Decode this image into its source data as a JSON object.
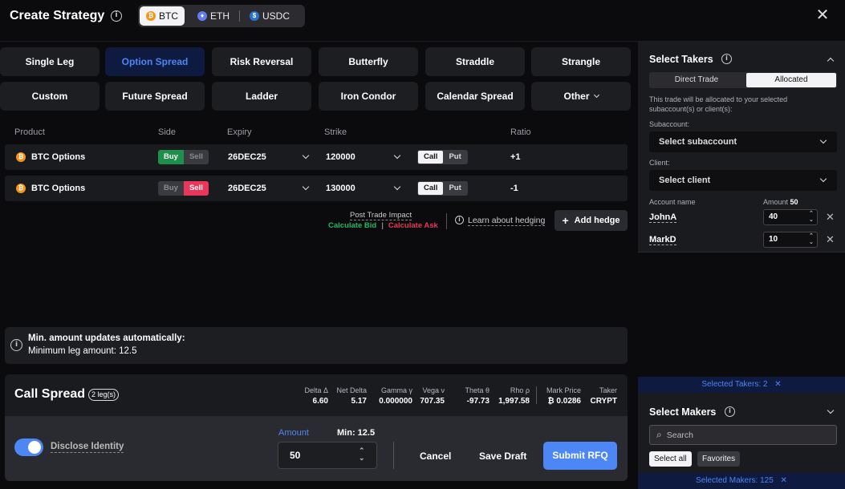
{
  "header": {
    "title": "Create Strategy",
    "assets": [
      {
        "label": "BTC",
        "active": true
      },
      {
        "label": "ETH",
        "active": false
      },
      {
        "label": "USDC",
        "active": false
      }
    ]
  },
  "strategies": [
    "Single Leg",
    "Option Spread",
    "Risk Reversal",
    "Butterfly",
    "Straddle",
    "Strangle",
    "Custom",
    "Future Spread",
    "Ladder",
    "Iron Condor",
    "Calendar Spread",
    "Other"
  ],
  "active_strategy": "Option Spread",
  "table": {
    "headers": [
      "Product",
      "Side",
      "Expiry",
      "Strike",
      "Ratio"
    ],
    "legs": [
      {
        "product": "BTC Options",
        "side_buy": "Buy",
        "side_sell": "Sell",
        "selected_side": "Buy",
        "expiry": "26DEC25",
        "strike": "120000",
        "type_call": "Call",
        "type_put": "Put",
        "selected_type": "Call",
        "ratio": "+1"
      },
      {
        "product": "BTC Options",
        "side_buy": "Buy",
        "side_sell": "Sell",
        "selected_side": "Sell",
        "expiry": "26DEC25",
        "strike": "130000",
        "type_call": "Call",
        "type_put": "Put",
        "selected_type": "Call",
        "ratio": "-1"
      }
    ]
  },
  "post_trade": {
    "label": "Post Trade Impact",
    "calc_bid": "Calculate Bid",
    "sep": "|",
    "calc_ask": "Calculate Ask",
    "hedging": "Learn about hedging",
    "add_hedge": "Add hedge"
  },
  "notice": {
    "title": "Min. amount updates automatically:",
    "text": "Minimum leg amount: 12.5"
  },
  "summary": {
    "title": "Call Spread",
    "legs_badge": "2 leg(s)",
    "greeks": [
      {
        "label": "Delta Δ",
        "value": "6.60"
      },
      {
        "label": "Net Delta",
        "value": "5.17"
      },
      {
        "label": "Gamma γ",
        "value": "0.000000"
      },
      {
        "label": "Vega ν",
        "value": "707.35"
      },
      {
        "label": "Theta θ",
        "value": "-97.73"
      },
      {
        "label": "Rho ρ",
        "value": "1,997.58"
      },
      {
        "label": "Mark Price",
        "value": "₿ 0.0286"
      },
      {
        "label": "Taker",
        "value": "CRYPT"
      }
    ]
  },
  "actions": {
    "disclose": "Disclose Identity",
    "disclose_on": true,
    "amount_label": "Amount",
    "min_label": "Min: 12.5",
    "amount_value": "50",
    "cancel": "Cancel",
    "save_draft": "Save Draft",
    "submit": "Submit RFQ"
  },
  "takers": {
    "title": "Select Takers",
    "tab_direct": "Direct Trade",
    "tab_allocated": "Allocated",
    "desc": "This trade will be allocated to your selected subaccount(s) or client(s):",
    "subaccount_label": "Subaccount:",
    "subaccount_placeholder": "Select subaccount",
    "client_label": "Client:",
    "client_placeholder": "Select client",
    "account_header": "Account name",
    "amount_header": "Amount",
    "amount_total": "50",
    "accounts": [
      {
        "name": "JohnA",
        "amount": "40"
      },
      {
        "name": "MarkD",
        "amount": "10"
      }
    ],
    "selected": "Selected Takers: 2"
  },
  "makers": {
    "title": "Select Makers",
    "search_placeholder": "Search",
    "select_all": "Select all",
    "favorites": "Favorites",
    "selected": "Selected Makers: 125"
  },
  "colors": {
    "accent": "#4d86f5",
    "buy": "#1f8f4c",
    "sell": "#e8375a",
    "panel": "#1a1b1f"
  }
}
